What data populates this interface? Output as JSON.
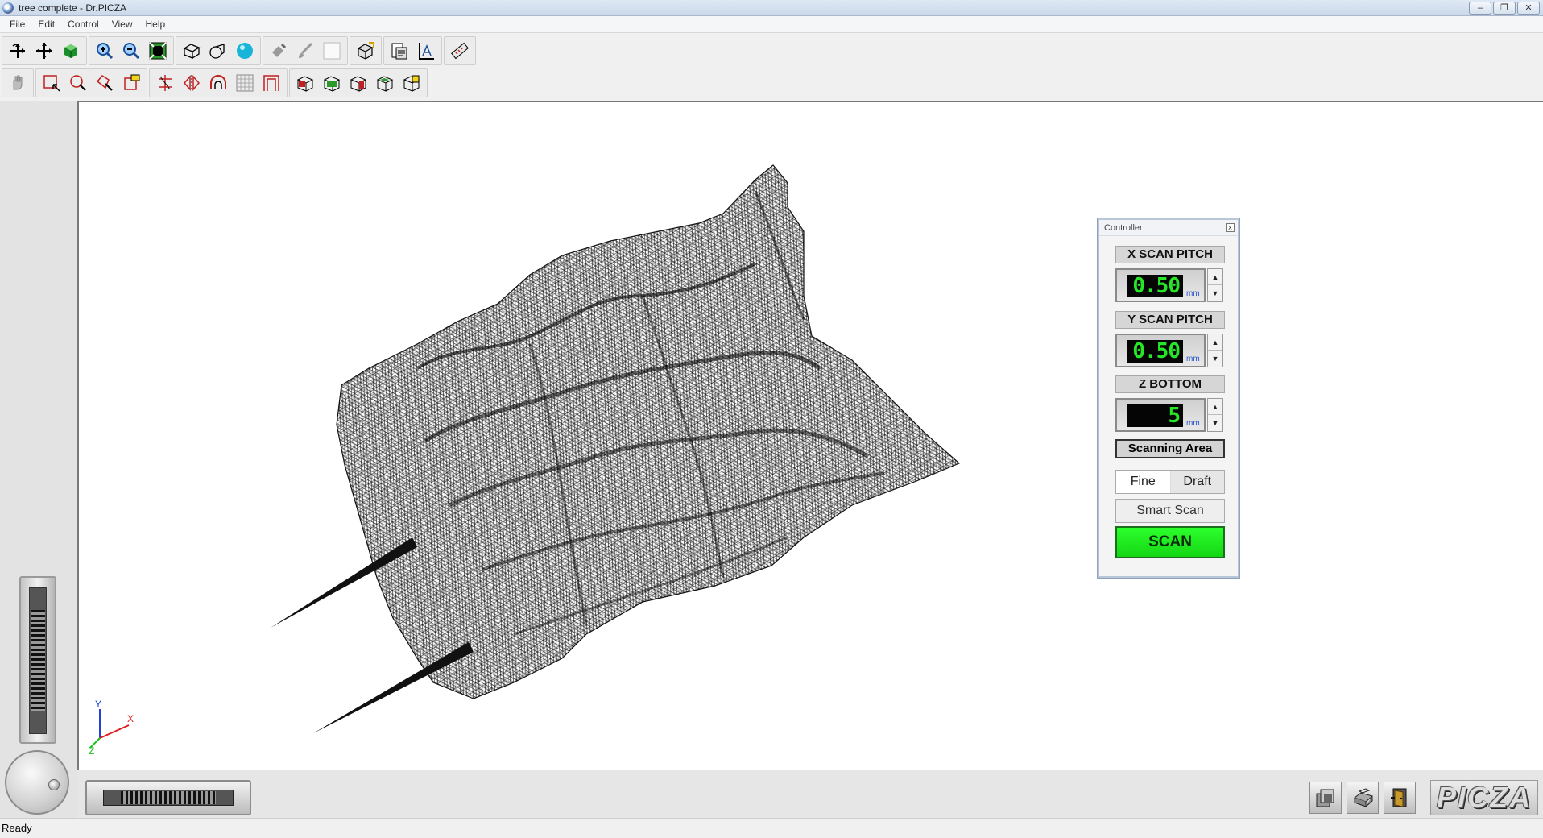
{
  "window": {
    "title": "tree complete - Dr.PICZA",
    "controls": {
      "minimize": "–",
      "restore": "❐",
      "close": "✕"
    }
  },
  "menu": [
    "File",
    "Edit",
    "Control",
    "View",
    "Help"
  ],
  "toolbar1": {
    "icons": [
      "rotate-icon",
      "move-icon",
      "color-cube-icon",
      "zoom-in-icon",
      "zoom-out-icon",
      "fit-view-icon",
      "wireframe-icon",
      "surface-icon",
      "sphere-icon",
      "paint-icon",
      "brush-icon",
      "blank-icon",
      "object-icon",
      "document-icon",
      "axis-grid-icon",
      "ruler-icon"
    ]
  },
  "toolbar2": {
    "icons": [
      "hand-icon",
      "rect-select-icon",
      "lasso-select-icon",
      "polygon-select-icon",
      "crop-icon",
      "cut-icon",
      "mirror-icon",
      "arch-icon",
      "grid-icon",
      "frame-icon",
      "view-front-icon",
      "view-back-icon",
      "view-side-icon",
      "view-top-icon",
      "view-iso-icon"
    ]
  },
  "axes": {
    "x": "X",
    "y": "Y",
    "z": "Z",
    "x_color": "#e02020",
    "y_color": "#2040e0",
    "z_color": "#20c020"
  },
  "controller": {
    "title": "Controller",
    "close": "x",
    "x_pitch": {
      "label": "X SCAN PITCH",
      "value": "0.50",
      "unit": "mm"
    },
    "y_pitch": {
      "label": "Y SCAN PITCH",
      "value": "0.50",
      "unit": "mm"
    },
    "z_bottom": {
      "label": "Z BOTTOM",
      "value": "5",
      "unit": "mm"
    },
    "scanning_area": "Scanning Area",
    "mode_fine": "Fine",
    "mode_draft": "Draft",
    "smart_scan": "Smart Scan",
    "scan": "SCAN",
    "spin_up": "▲",
    "spin_down": "▼",
    "accent": "#1ee61e"
  },
  "bottom": {
    "icons": [
      "cube-stack-icon",
      "print-icon",
      "exit-door-icon"
    ],
    "logo": "PICZA"
  },
  "status": "Ready"
}
